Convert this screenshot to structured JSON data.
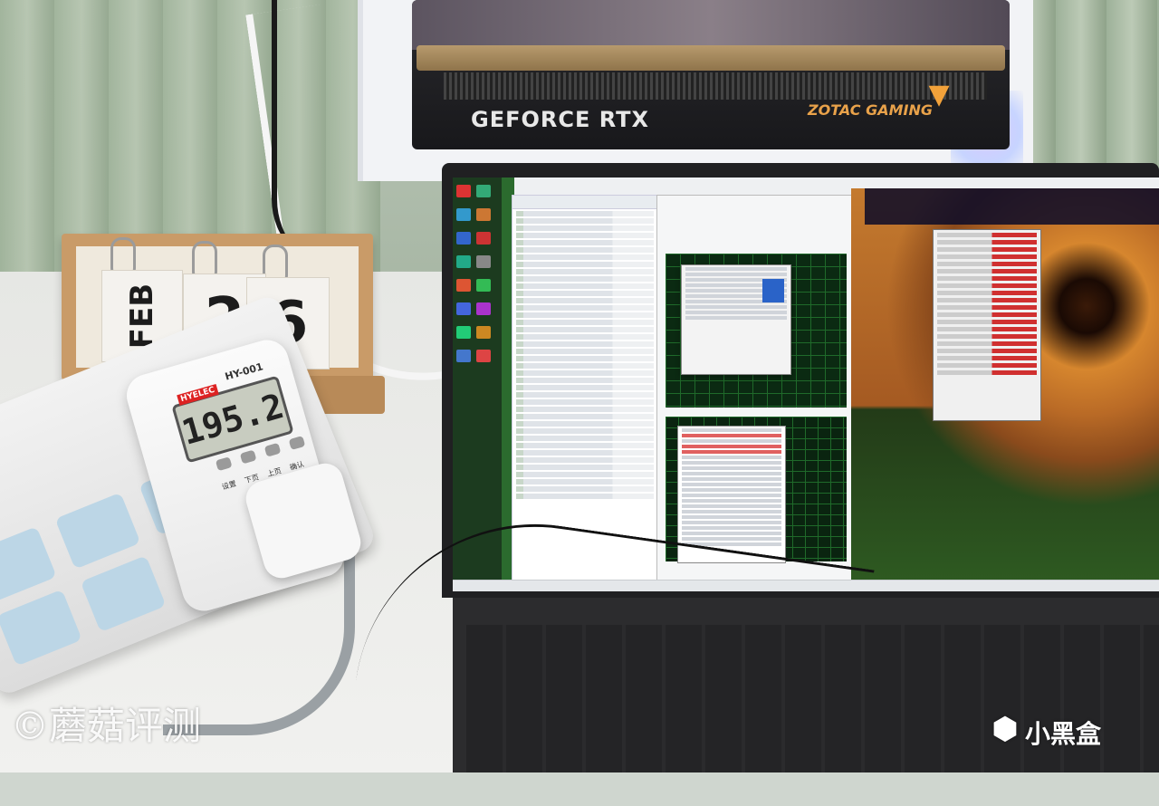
{
  "scene": {
    "gpu_brand": "GEFORCE RTX",
    "gpu_maker": "ZOTAC GAMING",
    "calendar": {
      "month": "FEB",
      "day_digit_1": "2",
      "day_digit_2": "6"
    },
    "power_meter": {
      "brand": "HYELEC",
      "model": "HY-001",
      "reading": "195.2",
      "buttons": [
        "设置",
        "下页",
        "上页",
        "确认"
      ]
    }
  },
  "watermarks": {
    "left": "©蘑菇评测",
    "right": "小黑盒"
  },
  "colors": {
    "accent_gpu": "#e9a24a",
    "graph_bg": "#0b2a12",
    "graph_grid": "#1f6a2a",
    "bar_red": "#d03030"
  }
}
